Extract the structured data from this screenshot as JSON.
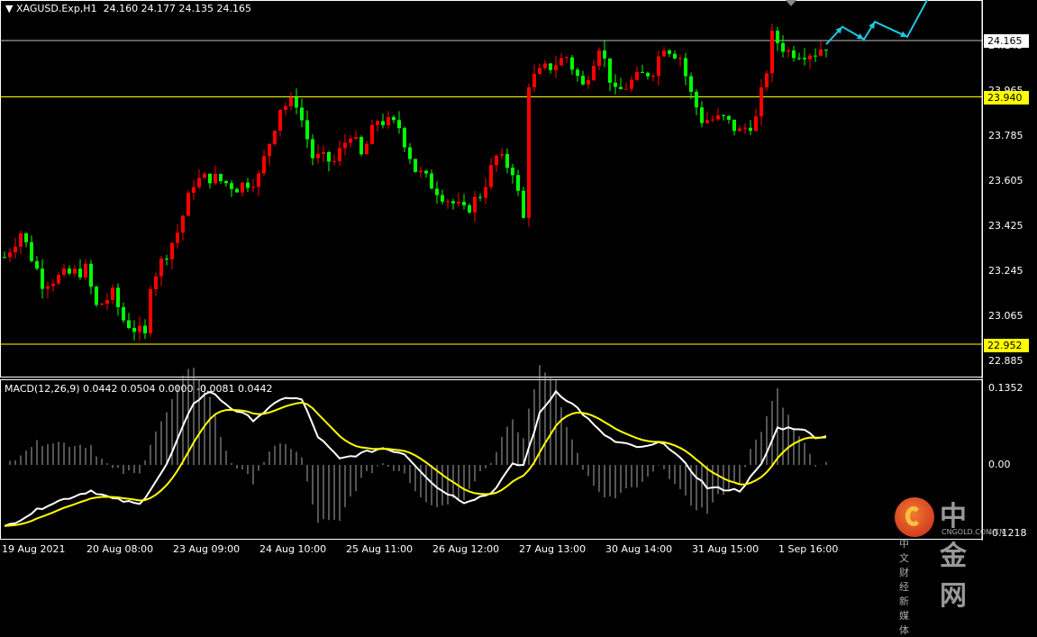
{
  "header": {
    "symbol": "XAGUSD.Exp,H1",
    "ohlc": "24.160 24.177 24.135 24.165"
  },
  "macd_header": {
    "label": "MACD(12,26,9) 0.0442 0.0504 0.0000 -0.0081 0.0442"
  },
  "price_axis": [
    "24.145",
    "23.965",
    "23.785",
    "23.605",
    "23.425",
    "23.245",
    "23.065",
    "22.885"
  ],
  "price_boxes": {
    "current": "24.165",
    "resistance": "23.940",
    "support": "22.952"
  },
  "macd_axis": {
    "top": "0.1352",
    "zero": "0.00",
    "bottom": "-0.1218"
  },
  "time_axis": [
    "19 Aug 2021",
    "20 Aug 08:00",
    "23 Aug 09:00",
    "24 Aug 10:00",
    "25 Aug 11:00",
    "26 Aug 12:00",
    "27 Aug 13:00",
    "30 Aug 14:00",
    "31 Aug 15:00",
    "1 Sep 16:00"
  ],
  "watermark": {
    "name": "中金网",
    "domain": "CNGOLD.COM.CN",
    "tagline": "中 文 财 经 新 媒 体"
  },
  "colors": {
    "bull": "#ff0000",
    "bear": "#00ff00",
    "line_current": "#c0c0c0",
    "line_level": "#ffff00",
    "forecast": "#1ec8e0",
    "macd": "#ffffff",
    "signal": "#ffff00"
  },
  "chart_data": {
    "type": "candlestick",
    "price_range": [
      22.82,
      24.33
    ],
    "levels": {
      "current": 24.165,
      "resistance": 23.94,
      "support": 22.952
    },
    "key_closes": [
      [
        0,
        23.3
      ],
      [
        3,
        23.4
      ],
      [
        7,
        23.2
      ],
      [
        15,
        23.25
      ],
      [
        17,
        23.1
      ],
      [
        20,
        23.15
      ],
      [
        22,
        23.05
      ],
      [
        26,
        22.98
      ],
      [
        27,
        23.2
      ],
      [
        32,
        23.4
      ],
      [
        35,
        23.6
      ],
      [
        38,
        23.62
      ],
      [
        43,
        23.58
      ],
      [
        47,
        23.62
      ],
      [
        51,
        23.9
      ],
      [
        54,
        23.92
      ],
      [
        57,
        23.7
      ],
      [
        61,
        23.68
      ],
      [
        64,
        23.8
      ],
      [
        66,
        23.7
      ],
      [
        69,
        23.85
      ],
      [
        73,
        23.82
      ],
      [
        76,
        23.65
      ],
      [
        81,
        23.55
      ],
      [
        85,
        23.48
      ],
      [
        88,
        23.55
      ],
      [
        91,
        23.7
      ],
      [
        94,
        23.65
      ],
      [
        96,
        23.45
      ],
      [
        97,
        24.0
      ],
      [
        100,
        24.05
      ],
      [
        104,
        24.1
      ],
      [
        107,
        23.98
      ],
      [
        110,
        24.15
      ],
      [
        113,
        23.95
      ],
      [
        116,
        24.0
      ],
      [
        120,
        24.05
      ],
      [
        122,
        24.15
      ],
      [
        125,
        24.1
      ],
      [
        127,
        23.95
      ],
      [
        129,
        23.85
      ],
      [
        133,
        23.85
      ],
      [
        136,
        23.8
      ],
      [
        139,
        23.85
      ],
      [
        141,
        24.05
      ],
      [
        142,
        24.18
      ],
      [
        145,
        24.12
      ],
      [
        150,
        24.12
      ],
      [
        152,
        24.15
      ]
    ],
    "macd_range": [
      -0.125,
      0.14
    ],
    "macd_keys": [
      [
        0,
        -0.11
      ],
      [
        8,
        -0.07
      ],
      [
        16,
        -0.045
      ],
      [
        20,
        -0.06
      ],
      [
        25,
        -0.07
      ],
      [
        30,
        0.0
      ],
      [
        35,
        0.11
      ],
      [
        38,
        0.13
      ],
      [
        42,
        0.1
      ],
      [
        46,
        0.08
      ],
      [
        52,
        0.12
      ],
      [
        55,
        0.115
      ],
      [
        58,
        0.05
      ],
      [
        62,
        0.01
      ],
      [
        66,
        0.02
      ],
      [
        70,
        0.03
      ],
      [
        74,
        0.02
      ],
      [
        80,
        -0.04
      ],
      [
        85,
        -0.065
      ],
      [
        90,
        -0.05
      ],
      [
        94,
        0.0
      ],
      [
        96,
        0.0
      ],
      [
        99,
        0.09
      ],
      [
        102,
        0.13
      ],
      [
        106,
        0.1
      ],
      [
        110,
        0.06
      ],
      [
        113,
        0.04
      ],
      [
        118,
        0.03
      ],
      [
        122,
        0.04
      ],
      [
        126,
        0.0
      ],
      [
        130,
        -0.04
      ],
      [
        136,
        -0.045
      ],
      [
        140,
        0.0
      ],
      [
        143,
        0.065
      ],
      [
        147,
        0.065
      ],
      [
        150,
        0.05
      ],
      [
        152,
        0.05
      ]
    ],
    "forecast_path": [
      [
        152,
        24.15
      ],
      [
        155,
        24.22
      ],
      [
        159,
        24.17
      ],
      [
        161,
        24.24
      ],
      [
        167,
        24.18
      ],
      [
        173,
        24.42
      ]
    ]
  }
}
